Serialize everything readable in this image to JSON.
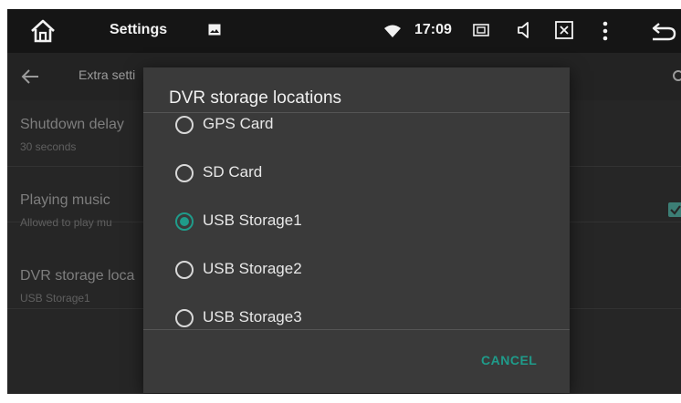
{
  "status_bar": {
    "app_title": "Settings",
    "clock": "17:09",
    "icons": [
      "home-icon",
      "gallery-icon",
      "wifi-icon",
      "screen-icon",
      "volume-icon",
      "close-box-icon",
      "more-vert-icon",
      "back-icon"
    ]
  },
  "app_bar": {
    "title": "Extra setti",
    "icons": [
      "back-arrow-icon",
      "search-icon"
    ]
  },
  "settings": [
    {
      "title": "Shutdown delay",
      "summary": "30 seconds"
    },
    {
      "title": "Playing music",
      "summary": "Allowed to play mu",
      "checked": true
    },
    {
      "title": "DVR storage loca",
      "summary": "USB Storage1"
    }
  ],
  "dialog": {
    "title": "DVR storage locations",
    "options": [
      {
        "label": "GPS Card",
        "selected": false
      },
      {
        "label": "SD Card",
        "selected": false
      },
      {
        "label": "USB Storage1",
        "selected": true
      },
      {
        "label": "USB Storage2",
        "selected": false
      },
      {
        "label": "USB Storage3",
        "selected": false
      }
    ],
    "cancel_label": "CANCEL"
  },
  "colors": {
    "accent": "#1f9b8a",
    "status_bar_bg": "#151515",
    "screen_bg": "#2f2f2f",
    "dialog_bg": "#3a3a3a"
  }
}
